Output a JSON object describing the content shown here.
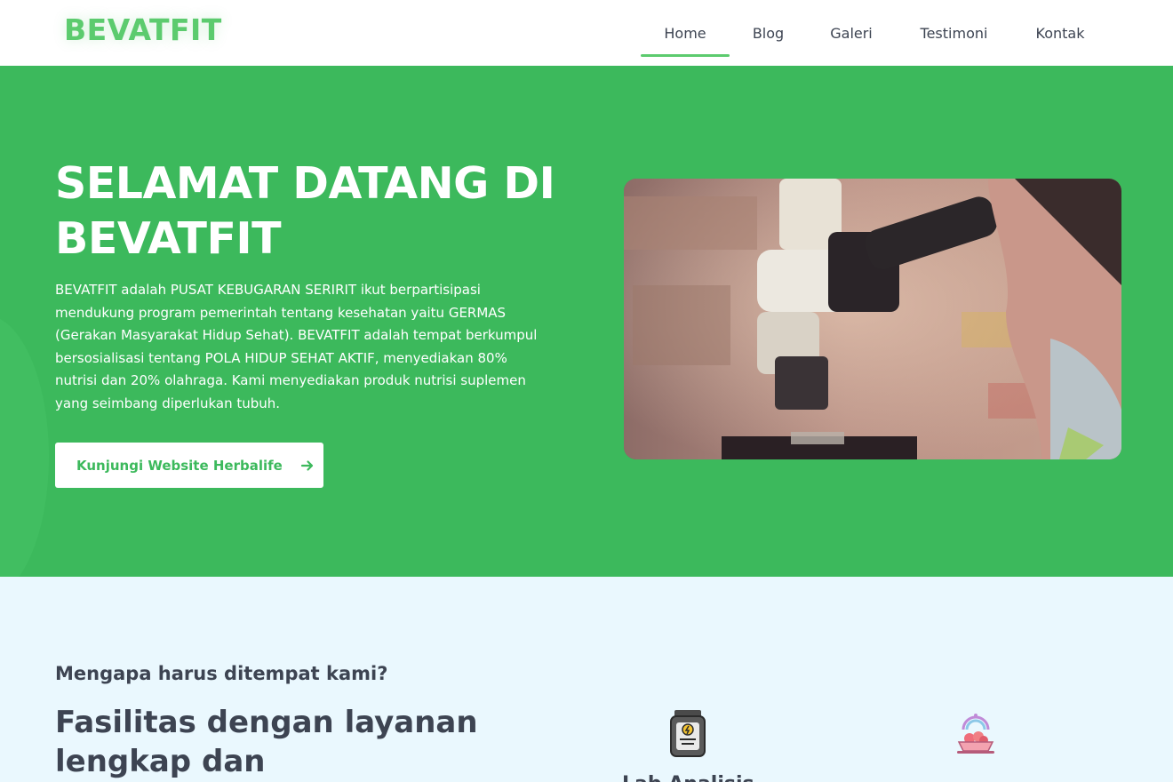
{
  "brand": {
    "name": "BEVATFIT",
    "color": "#5ccb6e"
  },
  "nav": {
    "items": [
      {
        "label": "Home",
        "active": true
      },
      {
        "label": "Blog",
        "active": false
      },
      {
        "label": "Galeri",
        "active": false
      },
      {
        "label": "Testimoni",
        "active": false
      },
      {
        "label": "Kontak",
        "active": false
      }
    ]
  },
  "hero": {
    "background": "#3cb95c",
    "title": "SELAMAT DATANG DI BEVATFIT",
    "description": "BEVATFIT adalah PUSAT KEBUGARAN SERIRIT ikut berpartisipasi mendukung program pemerintah tentang kesehatan yaitu GERMAS (Gerakan Masyarakat Hidup Sehat). BEVATFIT adalah tempat berkumpul bersosialisasi tentang POLA HIDUP SEHAT AKTIF, menyediakan 80% nutrisi dan 20% olahraga. Kami menyediakan produk nutrisi suplemen yang seimbang diperlukan tubuh.",
    "button_label": "Kunjungi Website Herbalife",
    "button_icon": "arrow-right-icon",
    "image": "scientist-microscope-photo"
  },
  "features": {
    "background": "#eaf8fe",
    "kicker": "Mengapa harus ditempat kami?",
    "heading": "Fasilitas dengan layanan lengkap dan",
    "items": [
      {
        "icon": "supplement-jar-icon",
        "title": "Lab Analisis"
      },
      {
        "icon": "healthy-food-bowl-icon",
        "title": ""
      }
    ]
  }
}
